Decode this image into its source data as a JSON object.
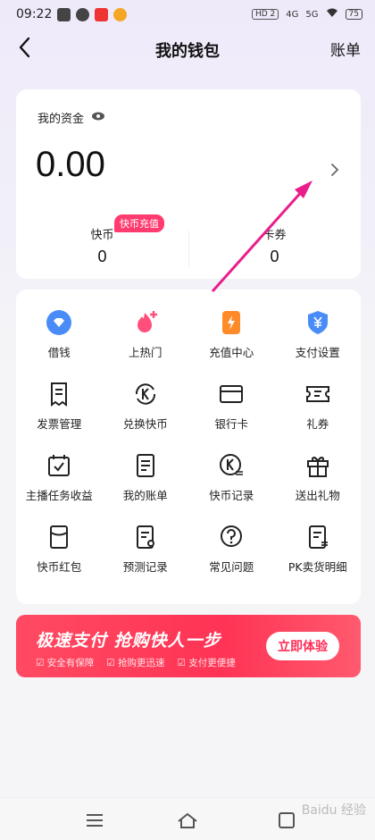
{
  "status_bar": {
    "time": "09:22",
    "network_left": "HD 2",
    "net_4g": "4G",
    "net_5g": "5G",
    "battery": "75"
  },
  "nav": {
    "title": "我的钱包",
    "right_label": "账单"
  },
  "wallet": {
    "label": "我的资金",
    "amount": "0.00",
    "kuaibi_label": "快币",
    "kuaibi_value": "0",
    "badge": "快币充值",
    "coupon_label": "卡券",
    "coupon_value": "0"
  },
  "grid": [
    {
      "label": "借钱",
      "icon": "diamond-shield-icon"
    },
    {
      "label": "上热门",
      "icon": "flame-plus-icon"
    },
    {
      "label": "充值中心",
      "icon": "lightning-icon"
    },
    {
      "label": "支付设置",
      "icon": "yen-shield-icon"
    },
    {
      "label": "发票管理",
      "icon": "invoice-icon"
    },
    {
      "label": "兑换快币",
      "icon": "exchange-k-icon"
    },
    {
      "label": "银行卡",
      "icon": "bank-card-icon"
    },
    {
      "label": "礼券",
      "icon": "ticket-icon"
    },
    {
      "label": "主播任务收益",
      "icon": "calendar-check-icon"
    },
    {
      "label": "我的账单",
      "icon": "bill-icon"
    },
    {
      "label": "快币记录",
      "icon": "k-record-icon"
    },
    {
      "label": "送出礼物",
      "icon": "gift-icon"
    },
    {
      "label": "快币红包",
      "icon": "red-packet-icon"
    },
    {
      "label": "预测记录",
      "icon": "forecast-doc-icon"
    },
    {
      "label": "常见问题",
      "icon": "question-icon"
    },
    {
      "label": "PK卖货明细",
      "icon": "pk-doc-icon"
    }
  ],
  "banner": {
    "title": "极速支付  抢购快人一步",
    "features": [
      "安全有保障",
      "抢购更迅速",
      "支付更便捷"
    ],
    "button": "立即体验"
  },
  "watermark": "Baidu 经验",
  "colors": {
    "accent": "#ff2d55",
    "badge": "#ff3b6f",
    "blue_icon": "#4a8cf7",
    "orange_icon": "#ff8a2a",
    "arrow": "#e91e8c"
  }
}
